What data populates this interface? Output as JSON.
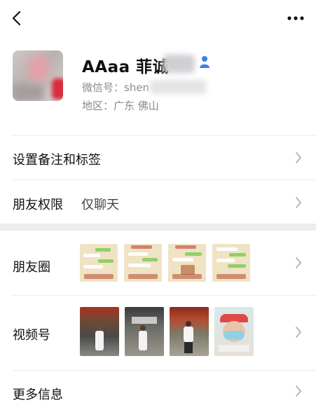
{
  "topbar": {
    "back_icon": "chevron-left-icon",
    "more_icon": "more-dots-icon"
  },
  "profile": {
    "avatar": "avatar-photo",
    "name": "AAaa 菲诚",
    "wechat_id": "微信号：shen",
    "region": "地区：广东  佛山",
    "gender_icon": "gender-icon",
    "gender_color": "#3e7ee8"
  },
  "rows": {
    "remark_label": "设置备注和标签",
    "permission_label": "朋友权限",
    "permission_value": "仅聊天",
    "moments_label": "朋友圈",
    "video_label": "视频号",
    "more_label": "更多信息"
  },
  "colors": {
    "background": "#ffffff",
    "section_gap": "#ededed",
    "secondary_text": "#8a8a8a",
    "chevron": "#b2b2b2"
  }
}
